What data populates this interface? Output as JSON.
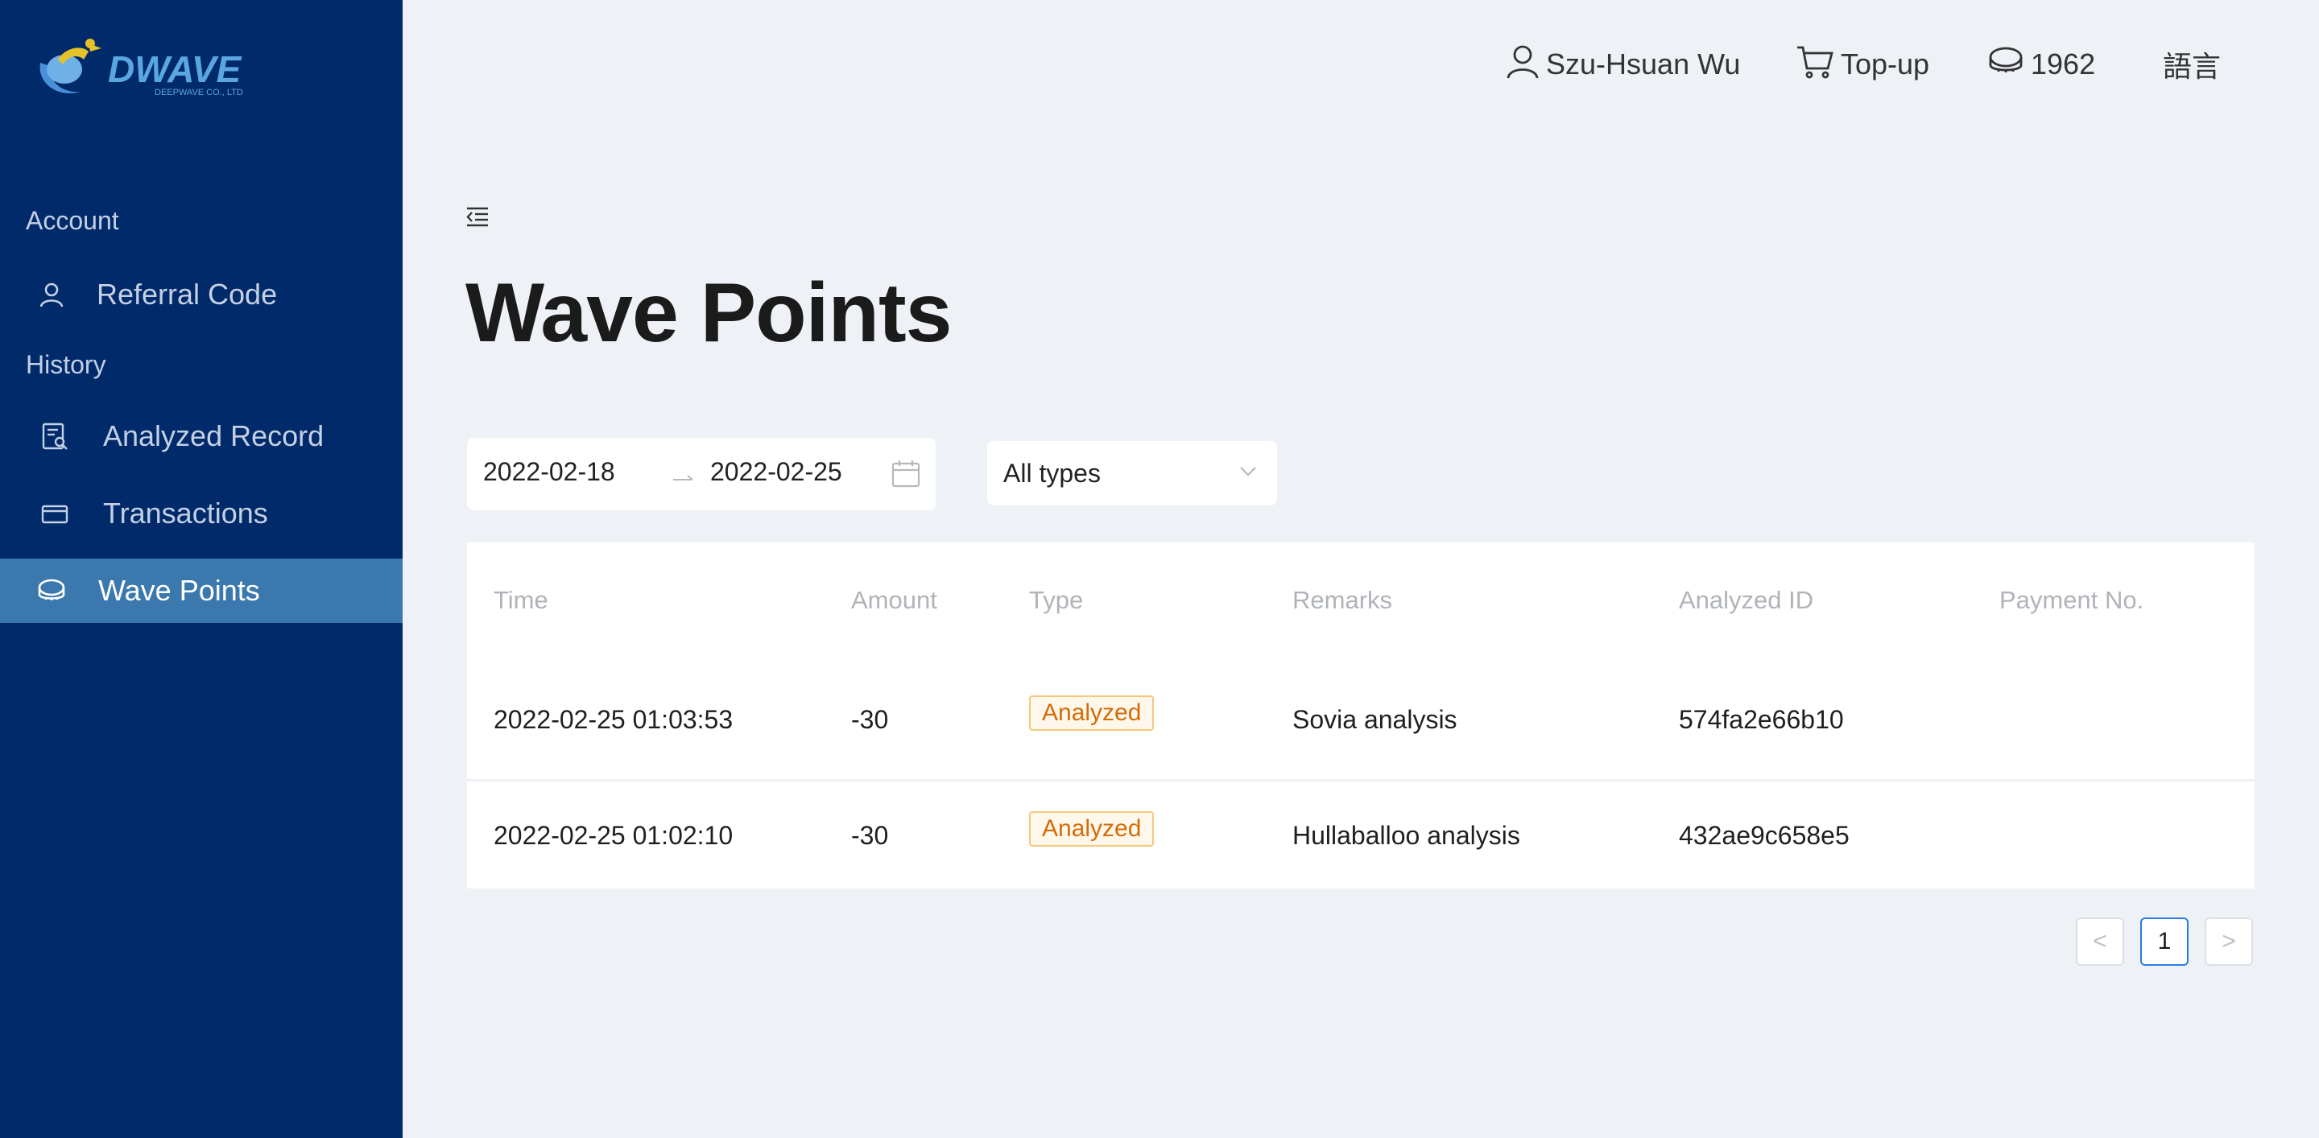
{
  "brand": {
    "name": "DWAVE",
    "subtitle": "DEEPWAVE CO., LTD"
  },
  "sidebar": {
    "sections": [
      {
        "label": "Account"
      },
      {
        "label": "History"
      }
    ],
    "items": [
      {
        "label": "Referral Code",
        "icon": "user-icon"
      },
      {
        "label": "Analyzed Record",
        "icon": "report-search-icon"
      },
      {
        "label": "Transactions",
        "icon": "card-icon"
      },
      {
        "label": "Wave Points",
        "icon": "coin-icon",
        "active": true
      }
    ]
  },
  "header": {
    "user_name": "Szu-Hsuan Wu",
    "topup_label": "Top-up",
    "points": "1962",
    "language_label": "語言"
  },
  "main": {
    "title": "Wave Points",
    "date_start": "2022-02-18",
    "date_end": "2022-02-25",
    "type_filter": "All types"
  },
  "table": {
    "columns": [
      "Time",
      "Amount",
      "Type",
      "Remarks",
      "Analyzed ID",
      "Payment No."
    ],
    "rows": [
      {
        "time": "2022-02-25 01:03:53",
        "amount": "-30",
        "type": "Analyzed",
        "remarks": "Sovia analysis",
        "analyzed_id": "574fa2e66b10",
        "payment_no": ""
      },
      {
        "time": "2022-02-25 01:02:10",
        "amount": "-30",
        "type": "Analyzed",
        "remarks": "Hullaballoo analysis",
        "analyzed_id": "432ae9c658e5",
        "payment_no": ""
      }
    ]
  },
  "pagination": {
    "current": "1",
    "prev_symbol": "<",
    "next_symbol": ">"
  },
  "colors": {
    "sidebar_bg": "#002a6a",
    "active_item_bg": "#3a78ad",
    "page_bg": "#eef1f5",
    "tag_color": "#d46b08",
    "accent": "#2a7de1"
  }
}
